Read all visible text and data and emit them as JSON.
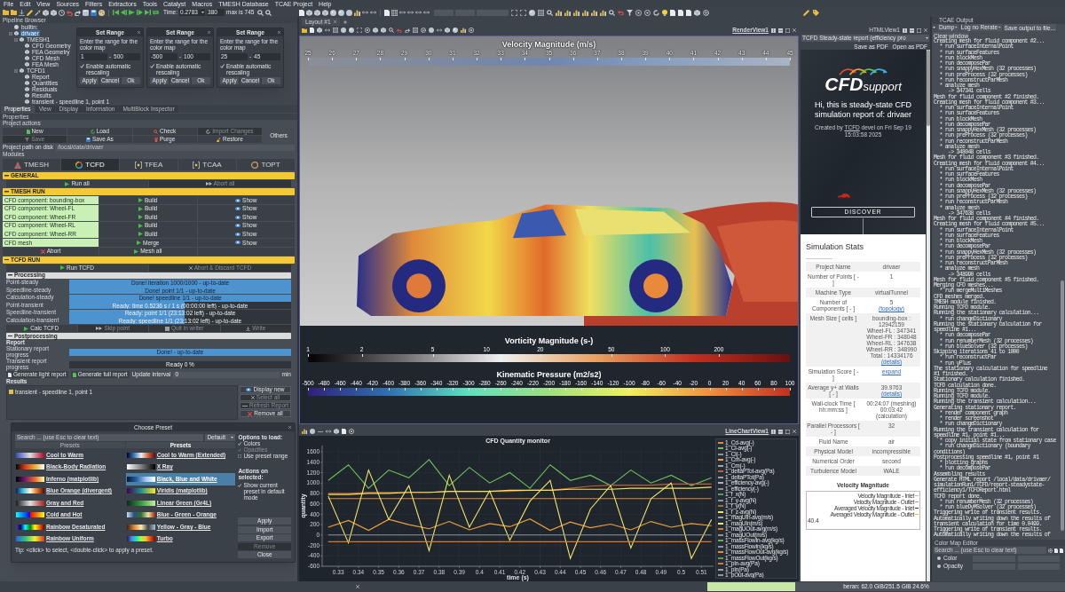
{
  "menu_bar": [
    "File",
    "Edit",
    "View",
    "Sources",
    "Filters",
    "Extractors",
    "Tools",
    "Catalyst",
    "Macros",
    "TMESH Database",
    "TCAE Project",
    "Help"
  ],
  "time_controls": {
    "label": "Time:",
    "value": "0.2783",
    "step": "380",
    "max": "max is 745"
  },
  "pipeline_browser": {
    "title": "Pipeline Browser",
    "tree": [
      {
        "label": "builtin:",
        "selected": false
      },
      {
        "label": "drivaer",
        "selected": true,
        "children": [
          {
            "label": "TMESH1",
            "selected": false,
            "children": [
              {
                "label": "CFD Geometry",
                "selected": false
              },
              {
                "label": "FEA Geometry",
                "selected": false
              },
              {
                "label": "CFD Mesh",
                "selected": false
              },
              {
                "label": "FEA Mesh",
                "selected": false
              }
            ]
          },
          {
            "label": "TCFD1",
            "selected": false,
            "children": [
              {
                "label": "Report",
                "selected": false
              },
              {
                "label": "Quantities",
                "selected": false
              },
              {
                "label": "Residuals",
                "selected": false
              },
              {
                "label": "Results",
                "selected": false
              },
              {
                "label": "transient - speedline 1, point 1",
                "selected": false
              }
            ]
          }
        ]
      }
    ]
  },
  "set_range_dialogs": [
    {
      "title": "Set Range",
      "prompt": "Enter the range for the color map",
      "min": "1",
      "separator": "-",
      "max": "500",
      "auto_rescale": true,
      "auto_rescale_label": "Enable automatic rescaling",
      "buttons": [
        "Apply",
        "Cancel",
        "Ok"
      ]
    },
    {
      "title": "Set Range",
      "prompt": "Enter the range for the color map",
      "min": "-500",
      "separator": "-",
      "max": "100",
      "auto_rescale": true,
      "auto_rescale_label": "Enable automatic rescaling",
      "buttons": [
        "Apply",
        "Cancel",
        "Ok"
      ]
    },
    {
      "title": "Set Range",
      "prompt": "Enter the range for the color map",
      "min": "25",
      "separator": "-",
      "max": "45",
      "auto_rescale": true,
      "auto_rescale_label": "Enable automatic rescaling",
      "buttons": [
        "Apply",
        "Cancel",
        "Ok"
      ]
    }
  ],
  "panel_tabs": [
    {
      "label": "Properties",
      "selected": true
    },
    {
      "label": "View",
      "selected": false
    },
    {
      "label": "Display",
      "selected": false
    },
    {
      "label": "Information",
      "selected": false
    },
    {
      "label": "MultiBlock Inspector",
      "selected": false
    }
  ],
  "properties": {
    "title": "Properties",
    "actions_label": "Project actions",
    "actions": [
      [
        {
          "label": "New",
          "disabled": false
        },
        {
          "label": "Load",
          "disabled": false
        },
        {
          "label": "Check",
          "disabled": false
        },
        {
          "label": "Import Changes",
          "disabled": true
        }
      ],
      [
        {
          "label": "Save",
          "disabled": true
        },
        {
          "label": "Save As",
          "disabled": false
        },
        {
          "label": "Purge",
          "disabled": false
        },
        {
          "label": "Restore",
          "disabled": false
        }
      ]
    ],
    "others": "Others",
    "path_label": "Project path on disk",
    "path_value": "/local/data/drivaer",
    "modules_label": "Modules",
    "modules": [
      {
        "label": "TMESH",
        "selected": false
      },
      {
        "label": "TCFD",
        "selected": true
      },
      {
        "label": "TFEA",
        "selected": false
      },
      {
        "label": "TCAA",
        "selected": false
      },
      {
        "label": "TOPT",
        "selected": false
      }
    ]
  },
  "general": {
    "title": "GENERAL",
    "buttons": [
      {
        "label": "Run all",
        "disabled": false
      },
      {
        "label": "Abort all",
        "disabled": true
      }
    ]
  },
  "tmesh_run": {
    "title": "TMESH RUN",
    "rows": [
      {
        "label": "CFD component: bounding-box",
        "action": "Build",
        "view": "Show"
      },
      {
        "label": "CFD component: Wheel-FL",
        "action": "Build",
        "view": "Show"
      },
      {
        "label": "CFD component: Wheel-FR",
        "action": "Build",
        "view": "Show"
      },
      {
        "label": "CFD component: Wheel-RL",
        "action": "Build",
        "view": "Show"
      },
      {
        "label": "CFD component: Wheel-RR",
        "action": "Build",
        "view": "Show"
      },
      {
        "label": "CFD mesh",
        "action": "Merge",
        "view": "Show"
      }
    ],
    "buttons": [
      {
        "label": "Abort",
        "kind": "stop"
      },
      {
        "label": "Mesh all",
        "kind": "run"
      }
    ]
  },
  "tcfd_run": {
    "title": "TCFD RUN",
    "buttons": [
      {
        "label": "Run TCFD",
        "disabled": false
      },
      {
        "label": "Abort & Discard TCFD",
        "disabled": true
      }
    ]
  },
  "processing": {
    "title": "Processing",
    "rows": [
      {
        "label": "Point-steady",
        "status": "Done! iteration 1000/1000 - up-to-date",
        "level": 1
      },
      {
        "label": "Speedline-steady",
        "status": "Done! point 1/1 - up-to-date",
        "level": 1
      },
      {
        "label": "Calculation-steady",
        "status": "Done! speedline 1/1 - up-to-date",
        "level": 1
      },
      {
        "label": "Point-transient",
        "status": "Ready: time 0.5236 s / 1 s (00:00:00 left) - up-to-date",
        "level": 0.52
      },
      {
        "label": "Speedline-transient",
        "status": "Ready: point 1/1 (23:13:02 left) - up-to-date",
        "level": 0.52
      },
      {
        "label": "Calculation-transient",
        "status": "Ready: speedline 1/1 (23:13:02 left) - up-to-date",
        "level": 0.52
      }
    ],
    "buttons": [
      {
        "label": "Calc TCFD",
        "disabled": false,
        "kind": "run"
      },
      {
        "label": "Skip point",
        "disabled": true,
        "kind": "skip"
      },
      {
        "label": "Quit in writer",
        "disabled": true,
        "kind": "square"
      },
      {
        "label": "Write",
        "disabled": true,
        "kind": "download"
      }
    ]
  },
  "postprocessing": {
    "title": "Postprocessing",
    "report_label": "Report",
    "rows": [
      {
        "label": "Stationary report progress",
        "status": "Done! - up-to-date",
        "level": 1
      },
      {
        "label": "Transient report progress",
        "status": "Ready 0 %",
        "level": 0
      }
    ],
    "report_buttons": [
      "Generate light report",
      "Generate full report"
    ],
    "interval_label": "Update interval",
    "interval_value": "0",
    "interval_unit": "min",
    "results_label": "Results",
    "results": [
      {
        "label": "transient - speedline 1, point 1",
        "selected": false
      }
    ],
    "result_buttons": [
      {
        "label": "Display new",
        "disabled": false,
        "kind": "eye"
      },
      {
        "label": "Select all",
        "disabled": true,
        "kind": "cross"
      },
      {
        "label": "Refresh Report",
        "disabled": true,
        "kind": "line"
      },
      {
        "label": "Remove all",
        "disabled": false,
        "kind": "stop"
      }
    ]
  },
  "choose_preset": {
    "title": "Choose Preset",
    "search_placeholder": "Search ... (use Esc to clear text)",
    "filter": "Default",
    "column_headers": [
      "Presets",
      "Presets"
    ],
    "presets": [
      {
        "label": "Cool to Warm",
        "selected": false
      },
      {
        "label": "Cool to Warm (Extended)",
        "selected": false
      },
      {
        "label": "Black-Body Radiation",
        "selected": false
      },
      {
        "label": "X Ray",
        "selected": false
      },
      {
        "label": "Inferno (matplotlib)",
        "selected": false
      },
      {
        "label": "Black, Blue and White",
        "selected": true
      },
      {
        "label": "Blue Orange (divergent)",
        "selected": false
      },
      {
        "label": "Viridis (matplotlib)",
        "selected": false
      },
      {
        "label": "Gray and Red",
        "selected": false
      },
      {
        "label": "Linear Green (Gr4L)",
        "selected": false
      },
      {
        "label": "Cold and Hot",
        "selected": false
      },
      {
        "label": "Blue - Green - Orange",
        "selected": false
      },
      {
        "label": "Rainbow Desaturated",
        "selected": false
      },
      {
        "label": "Yellow - Gray - Blue",
        "selected": false
      },
      {
        "label": "Rainbow Uniform",
        "selected": false
      },
      {
        "label": "Turbo",
        "selected": false
      }
    ],
    "options_title": "Options to load:",
    "options": [
      {
        "label": "Colors",
        "checked": true,
        "disabled": false
      },
      {
        "label": "Opacities",
        "checked": true,
        "disabled": true
      },
      {
        "label": "Use preset range",
        "checked": false,
        "disabled": false
      }
    ],
    "actions_title": "Actions on selected:",
    "actions": [
      {
        "label": "Show current preset in default mode",
        "checked": true
      }
    ],
    "buttons": [
      {
        "label": "Apply",
        "disabled": false
      },
      {
        "label": "Import",
        "disabled": false
      },
      {
        "label": "Export",
        "disabled": false
      },
      {
        "label": "Remove",
        "disabled": true
      },
      {
        "label": "Close",
        "disabled": false
      }
    ],
    "tip": "Tip: <click> to select, <double-click> to apply a preset."
  },
  "layout_tab": {
    "label": "Layout #1"
  },
  "render_view": {
    "title": "RenderView1",
    "colorbars": [
      {
        "title": "Velocity Magnitude (m/s)",
        "log_scale": false,
        "ticks": [
          "25",
          "26",
          "27",
          "28",
          "29",
          "30",
          "31",
          "32",
          "33",
          "34",
          "35",
          "36",
          "37",
          "38",
          "39",
          "40",
          "41",
          "42",
          "43",
          "44",
          "45"
        ]
      },
      {
        "title": "Vorticity Magnitude (s-)",
        "log_scale": true,
        "ticks": [
          "1",
          "2",
          "5",
          "10",
          "20",
          "50",
          "100",
          "200"
        ]
      },
      {
        "title": "Kinematic Pressure (m2/s2)",
        "log_scale": false,
        "ticks": [
          "-500",
          "-480",
          "-460",
          "-440",
          "-420",
          "-400",
          "-380",
          "-360",
          "-340",
          "-320",
          "-300",
          "-280",
          "-260",
          "-240",
          "-220",
          "-200",
          "-180",
          "-160",
          "-140",
          "-120",
          "-100",
          "-80",
          "-60",
          "-40",
          "-20",
          "0",
          "20",
          "40",
          "60",
          "80",
          "100"
        ]
      }
    ]
  },
  "line_chart": {
    "title": "LineChartView1",
    "chart_data": {
      "type": "line",
      "title": "CFD Quantity monitor",
      "xlabel": "time (s)",
      "ylabel": "quantity",
      "grid": true,
      "legend": "right",
      "x": [
        0.325,
        0.335,
        0.345,
        0.355,
        0.365,
        0.375,
        0.385,
        0.395,
        0.405,
        0.415,
        0.425,
        0.435,
        0.445,
        0.455,
        0.465,
        0.475,
        0.485,
        0.495,
        0.505,
        0.515
      ],
      "xlim": [
        0.322,
        0.516
      ],
      "ylim": [
        -600,
        1720
      ],
      "xticks": [
        0.33,
        0.34,
        0.35,
        0.36,
        0.37,
        0.38,
        0.39,
        0.4,
        0.41,
        0.42,
        0.43,
        0.44,
        0.45,
        0.46,
        0.47,
        0.48,
        0.49,
        0.5,
        0.51
      ],
      "yticks": [
        -600,
        -400,
        -200,
        0,
        200,
        400,
        600,
        800,
        1000,
        1200,
        1400,
        1600
      ],
      "series": [
        {
          "name": "1_Cd-avg(-)",
          "color": "#e8872e",
          "values": [
            700,
            700,
            700,
            700,
            700,
            700,
            700,
            700,
            700,
            700,
            700,
            700,
            700,
            700,
            700,
            700,
            700,
            700,
            700,
            700
          ]
        },
        {
          "name": "1_Cl-avg(-)",
          "color": "#6fbf5f",
          "values": [
            1050,
            1350,
            900,
            1250,
            1100,
            1450,
            950,
            1300,
            1000,
            1200,
            900,
            1350,
            1050,
            1150,
            950,
            1250,
            1000,
            1150,
            950,
            1100
          ]
        },
        {
          "name": "1_Cl(-)",
          "color": "#8e96a3",
          "values": [
            null,
            null,
            null,
            null,
            null,
            null,
            null,
            null,
            null,
            null,
            null,
            null,
            null,
            null,
            null,
            null,
            null,
            null,
            null,
            null
          ]
        },
        {
          "name": "1_Cm-avg(-)",
          "color": "#f0a040",
          "values": [
            150,
            280,
            90,
            300,
            200,
            120,
            260,
            100,
            220,
            160,
            310,
            90,
            250,
            140,
            210,
            100,
            260,
            150,
            220,
            180
          ]
        },
        {
          "name": "1_Cm(-)",
          "color": "#a0a6ae",
          "values": [
            null,
            null,
            null,
            null,
            null,
            null,
            null,
            null,
            null,
            null,
            null,
            null,
            null,
            null,
            null,
            null,
            null,
            null,
            null,
            null
          ]
        },
        {
          "name": "1_deltaPTot-avg(Pa)",
          "color": "#c0603a",
          "values": [
            800,
            800,
            820,
            820,
            820,
            820,
            840,
            840,
            840,
            840,
            860,
            860,
            900,
            940,
            960,
            960,
            960,
            980,
            980,
            980
          ]
        },
        {
          "name": "1_deltaPTot(Pa)",
          "color": "#9aa0a8",
          "values": [
            null,
            null,
            null,
            null,
            null,
            null,
            null,
            null,
            null,
            null,
            null,
            null,
            null,
            null,
            null,
            null,
            null,
            null,
            null,
            null
          ]
        },
        {
          "name": "1_efficiency-avg(-)",
          "color": "#b0b4ba",
          "values": [
            null,
            null,
            null,
            null,
            null,
            null,
            null,
            null,
            null,
            null,
            null,
            null,
            null,
            null,
            null,
            null,
            null,
            null,
            null,
            null
          ]
        },
        {
          "name": "1_efficiency(-)",
          "color": "#8a9099",
          "values": [
            null,
            null,
            null,
            null,
            null,
            null,
            null,
            null,
            null,
            null,
            null,
            null,
            null,
            null,
            null,
            null,
            null,
            null,
            null,
            null
          ]
        },
        {
          "name": "1_f_x(N)",
          "color": "#5a9e52",
          "values": [
            null,
            null,
            null,
            null,
            null,
            null,
            null,
            null,
            null,
            null,
            null,
            null,
            null,
            null,
            null,
            null,
            null,
            null,
            null,
            null
          ]
        },
        {
          "name": "1_f_y-avg(N)",
          "color": "#8f959d",
          "values": [
            null,
            null,
            null,
            null,
            null,
            null,
            null,
            null,
            null,
            null,
            null,
            null,
            null,
            null,
            null,
            null,
            null,
            null,
            null,
            null
          ]
        },
        {
          "name": "1_f_y(N)",
          "color": "#a07040",
          "values": [
            null,
            null,
            null,
            null,
            null,
            null,
            null,
            null,
            null,
            null,
            null,
            null,
            null,
            null,
            null,
            null,
            null,
            null,
            null,
            null
          ]
        },
        {
          "name": "1_f_z-avg(N)",
          "color": "#f5e35a",
          "values": [
            780,
            780,
            800,
            800,
            820,
            820,
            840,
            840,
            840,
            860,
            860,
            860,
            880,
            880,
            880,
            900,
            900,
            900,
            900,
            920
          ]
        },
        {
          "name": "1_magUIn-avg(m/s)",
          "color": "#9ca2aa",
          "values": [
            null,
            null,
            null,
            null,
            null,
            null,
            null,
            null,
            null,
            null,
            null,
            null,
            null,
            null,
            null,
            null,
            null,
            null,
            null,
            null
          ]
        },
        {
          "name": "1_magUIn(m/s)",
          "color": "#f2e56b",
          "values": [
            750,
            -150,
            1250,
            300,
            950,
            -300,
            1150,
            150,
            850,
            -100,
            650,
            1050,
            -450,
            500,
            950,
            -250,
            700,
            1000,
            -450,
            300
          ]
        },
        {
          "name": "1_magUOut-avg(m/s)",
          "color": "#d9782e",
          "values": [
            -130,
            -130,
            -130,
            -130,
            -130,
            -130,
            -130,
            -130,
            -130,
            -130,
            -130,
            -130,
            -130,
            -130,
            -130,
            -130,
            -130,
            -130,
            -130,
            -130
          ]
        },
        {
          "name": "1_magUOut(m/s)",
          "color": "#8e949c",
          "values": [
            null,
            null,
            null,
            null,
            null,
            null,
            null,
            null,
            null,
            null,
            null,
            null,
            null,
            null,
            null,
            null,
            null,
            null,
            null,
            null
          ]
        },
        {
          "name": "1_massFlowIn-avg(kg/s)",
          "color": "#6aa95a",
          "values": [
            null,
            null,
            null,
            null,
            null,
            null,
            null,
            null,
            null,
            null,
            null,
            null,
            null,
            null,
            null,
            null,
            null,
            null,
            null,
            null
          ]
        },
        {
          "name": "1_massFlowIn(kg/s)",
          "color": "#8e949d",
          "values": [
            null,
            null,
            null,
            null,
            null,
            null,
            null,
            null,
            null,
            null,
            null,
            null,
            null,
            null,
            null,
            null,
            null,
            null,
            null,
            null
          ]
        },
        {
          "name": "1_massFlowOut-avg(kg/s)",
          "color": "#e89030",
          "values": [
            null,
            null,
            null,
            null,
            null,
            null,
            null,
            null,
            null,
            null,
            null,
            null,
            null,
            null,
            null,
            null,
            null,
            null,
            null,
            null
          ]
        },
        {
          "name": "1_massFlowOut(kg/s)",
          "color": "#5e9c50",
          "values": [
            null,
            null,
            null,
            null,
            null,
            null,
            null,
            null,
            null,
            null,
            null,
            null,
            null,
            null,
            null,
            null,
            null,
            null,
            null,
            null
          ]
        },
        {
          "name": "1_pIn-avg(Pa)",
          "color": "#d97a30",
          "values": [
            null,
            null,
            null,
            null,
            null,
            null,
            null,
            null,
            null,
            null,
            null,
            null,
            null,
            null,
            null,
            null,
            null,
            null,
            null,
            null
          ]
        },
        {
          "name": "1_pIn(Pa)",
          "color": "#9aa0a9",
          "values": [
            null,
            null,
            null,
            null,
            null,
            null,
            null,
            null,
            null,
            null,
            null,
            null,
            null,
            null,
            null,
            null,
            null,
            null,
            null,
            null
          ]
        },
        {
          "name": "1_pOut-avg(Pa)",
          "color": "#8e959c",
          "values": [
            0,
            0,
            0,
            0,
            0,
            0,
            0,
            0,
            0,
            0,
            0,
            0,
            0,
            0,
            0,
            0,
            0,
            0,
            0,
            0
          ]
        }
      ]
    }
  },
  "html_view": {
    "title": "HTMLView1",
    "report_select": "TCFD Steady-state report (efficiency pro",
    "buttons": [
      "Save as PDF",
      "Open as PDF"
    ],
    "report": {
      "logo_bold": "CFD",
      "logo_light": "support",
      "heading": "Hi, this is steady-state CFD simulation report of: drivaer",
      "created_prefix": "Created by",
      "created_link": "TCFD",
      "created_suffix": "devel on Fri Sep 19 15:03:58 2025",
      "discover": "DISCOVER",
      "stats_title": "Simulation Stats",
      "stats": [
        {
          "label": "Project Name",
          "value": [
            {
              "text": "drivaer",
              "link": false
            }
          ]
        },
        {
          "label": "Number of Points [ - ]",
          "value": [
            {
              "text": "1",
              "link": false
            }
          ]
        },
        {
          "label": "Machine Type",
          "value": [
            {
              "text": "virtualTunnel",
              "link": false
            }
          ]
        },
        {
          "label": "Number of Components [ - ]",
          "value": [
            {
              "text": "5",
              "link": false
            },
            {
              "text": "(topology)",
              "link": true
            }
          ]
        },
        {
          "label": "Mesh Size [ cells ]",
          "value": [
            {
              "text": "bounding-box :",
              "link": false
            },
            {
              "text": "12942159",
              "link": false
            },
            {
              "text": "Wheel-FL : 347341",
              "link": false
            },
            {
              "text": "Wheel-FR : 348048",
              "link": false
            },
            {
              "text": "Wheel-RL : 347638",
              "link": false
            },
            {
              "text": "Wheel-RR : 348990",
              "link": false
            },
            {
              "text": "Total : 14334176",
              "link": false
            },
            {
              "text": "(details)",
              "link": true
            }
          ]
        },
        {
          "label": "Simulation Score [ - ]",
          "value": [
            {
              "text": "expand",
              "link": true
            }
          ]
        },
        {
          "label": "Average y+ at Walls [ - ]",
          "value": [
            {
              "text": "39.9763",
              "link": false
            },
            {
              "text": "(details)",
              "link": true
            }
          ]
        },
        {
          "label": "Wall-clock Time [ hh:mm:ss ]",
          "value": [
            {
              "text": "00:24:07 (meshing)",
              "link": false
            },
            {
              "text": "00:03:42",
              "link": false
            },
            {
              "text": "(calculation)",
              "link": false
            }
          ]
        },
        {
          "label": "Parallel Processors [ - ]",
          "value": [
            {
              "text": "32",
              "link": false
            }
          ]
        },
        {
          "label": "Fluid Name",
          "value": [
            {
              "text": "air",
              "link": false
            }
          ]
        },
        {
          "label": "Physical Model",
          "value": [
            {
              "text": "incompressible",
              "link": false
            }
          ]
        },
        {
          "label": "Numerical Order",
          "value": [
            {
              "text": "second",
              "link": false
            }
          ]
        },
        {
          "label": "Turbulence Model",
          "value": [
            {
              "text": "WALE",
              "link": false
            }
          ]
        }
      ],
      "mini_chart": {
        "title": "Velocity Magnitude",
        "tick": "40.4",
        "legend": [
          {
            "label": "Velocity Magnitude - Inlet",
            "color": "#b8b8b8"
          },
          {
            "label": "Velocity Magnitude - Outlet",
            "color": "#e07a7a"
          },
          {
            "label": "Averaged Velocity Magnitude - Inlet",
            "color": "#303030"
          },
          {
            "label": "Averaged Velocity Magnitude - Outlet",
            "color": "#e0c040"
          }
        ]
      }
    }
  },
  "tcae_output": {
    "title": "TCAE Output",
    "controls": [
      {
        "label": "Dump",
        "kind": "dropdown"
      },
      {
        "label": "Log no Rerate",
        "kind": "dropdown"
      },
      {
        "label": "Save output to file...",
        "kind": "button"
      },
      {
        "label": "Clear window",
        "kind": "button"
      }
    ],
    "lines": [
      "Creating mesh for fluid component #2...",
      "  * run surfaceInternalPoint",
      "  * run surfaceFeatures",
      "  * run blockMesh",
      "  * run decomposePar",
      "  * run snappyHexMesh (32 processes)",
      "  * run preProcess (32 processes)",
      "  * run reconstructParMesh",
      "  * analyze mesh",
      "     -> 347341 cells",
      "Mesh for fluid component #2 finished.",
      "Creating mesh for fluid component #3...",
      "  * run surfaceInternalPoint",
      "  * run surfaceFeatures",
      "  * run blockMesh",
      "  * run decomposePar",
      "  * run snappyHexMesh (32 processes)",
      "  * run preProcess (32 processes)",
      "  * run reconstructParMesh",
      "  * analyze mesh",
      "     -> 348048 cells",
      "Mesh for fluid component #3 finished.",
      "Creating mesh for fluid component #4...",
      "  * run surfaceInternalPoint",
      "  * run surfaceFeatures",
      "  * run blockMesh",
      "  * run decomposePar",
      "  * run snappyHexMesh (32 processes)",
      "  * run preProcess (32 processes)",
      "  * run reconstructParMesh",
      "  * analyze mesh",
      "     -> 347638 cells",
      "Mesh for fluid component #4 finished.",
      "Creating mesh for fluid component #5...",
      "  * run surfaceInternalPoint",
      "  * run surfaceFeatures",
      "  * run blockMesh",
      "  * run decomposePar",
      "  * run snappyHexMesh (32 processes)",
      "  * run preProcess (32 processes)",
      "  * run reconstructParMesh",
      "  * analyze mesh",
      "     -> 348990 cells",
      "Mesh for fluid component #5 finished.",
      "Merging CFD meshes...",
      "  * run mergeMultiMeshes",
      "CFD meshes merged.",
      "TMESH module finished.",
      "Running TCFD module.",
      "Running the stationary calculation...",
      "  * run changeDictionary",
      "Running the stationary calculation for",
      "speedline #1...",
      "  * run decomposePar",
      "  * run renumberMesh (32 processes)",
      "  * run blueSolver (32 processes)",
      "Skipping iterations 41 to 1000",
      "  * run reconstructPar",
      "  * run yPlus",
      "The stationary calculation for speedline",
      "#1 finished.",
      "Stationary calculation finished.",
      "TCFD calculation done.",
      "Running TCFD module.",
      "Running TCFD module.",
      "Running the transient calculation...",
      "Generating stationary report.",
      "  * render component graph",
      "  * render screenshot",
      "  * run changeDictionary",
      "Running the transient calculation for",
      "speedline #1, point #1...",
      "  * copy initial state from stationary case",
      "  * run changeDictionary (boundary",
      "conditions)",
      "Postprocessing speedline #1, point #1",
      "  * plotting graphs",
      "  * run decomposePar",
      "Assembling results",
      "Generate HTML report /local/data/drivaer/",
      "simulationRun1/TCFD/report-steadystate-",
      "efficiency1/TCFDReport.html",
      "TCFD report done.",
      "  * run renumberMesh (32 processes)",
      "  * run blueDyMSolver (32 processes)",
      "Triggering write of transient results.",
      "Automatically writing down the results of",
      "transient calculation for time 0.0499.",
      "Triggering write of transient results.",
      "Automatically writing down the results of"
    ]
  },
  "color_map_editor": {
    "title": "Color Map Editor",
    "search_placeholder": "Search ... (use Esc to clear text)",
    "rows": [
      {
        "label": "Color",
        "disabled": false
      },
      {
        "label": "Opacity",
        "disabled": false
      }
    ]
  },
  "status_bar": {
    "meters": [
      {
        "label": "beran: 62.0 GiB/251.5 GiB 24.6%",
        "level": 0.246
      }
    ]
  }
}
